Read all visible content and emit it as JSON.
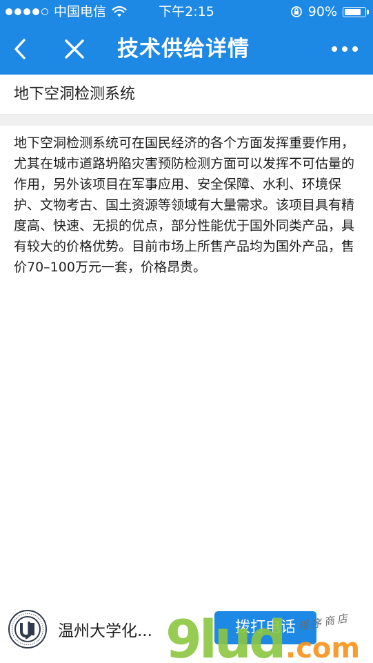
{
  "status_bar": {
    "carrier": "中国电信",
    "time": "下午2:15",
    "battery": "90%",
    "battery_level": 0.9
  },
  "nav": {
    "title": "技术供给详情"
  },
  "content": {
    "title": "地下空洞检测系统",
    "description": "地下空洞检测系统可在国民经济的各个方面发挥重要作用，尤其在城市道路坍陷灾害预防检测方面可以发挥不可估量的作用，另外该项目在军事应用、安全保障、水利、环境保护、文物考古、国土资源等领域有大量需求。该项目具有精度高、快速、无损的优点，部分性能优于国外同类产品，具有较大的价格优势。目前市场上所售产品均为国外产品，售价70–100万元一套，价格昂贵。"
  },
  "footer": {
    "institution_name": "温州大学化...",
    "call_button_label": "拨打电话"
  },
  "watermark": {
    "logo_text": "9lud",
    "domain": ".com",
    "script_text": "程序商店"
  },
  "colors": {
    "primary": "#1e88e5",
    "watermark_green": "#8cc63f",
    "watermark_orange": "#f7941d"
  }
}
